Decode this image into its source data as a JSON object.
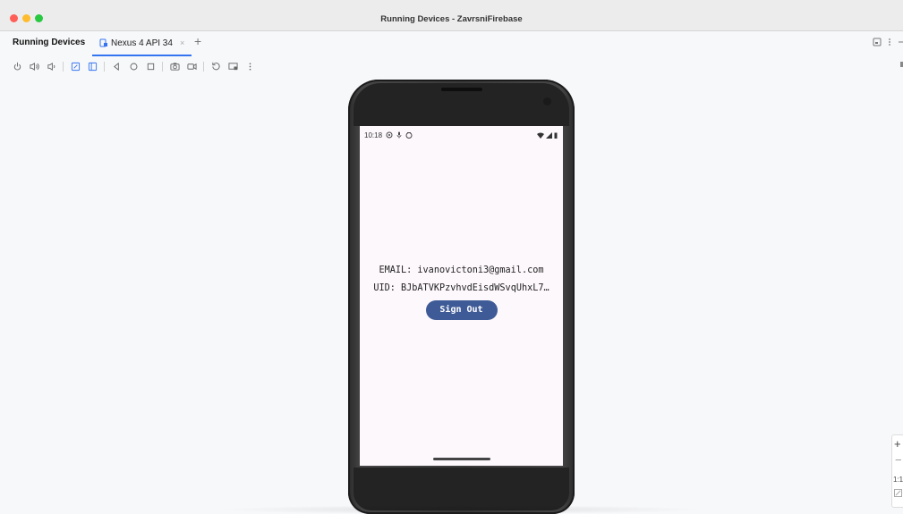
{
  "window": {
    "title": "Running Devices - ZavrsniFirebase"
  },
  "tabbar": {
    "panel_title": "Running Devices",
    "device_tab_label": "Nexus 4 API 34",
    "close_glyph": "×",
    "add_glyph": "+",
    "right_icons": [
      "window-icon",
      "more-icon",
      "minimize-icon"
    ]
  },
  "toolbar": {
    "buttons": [
      "power-icon",
      "volume-up-icon",
      "volume-down-icon",
      "rotate-left-icon",
      "rotate-right-icon",
      "back-icon",
      "home-icon",
      "overview-icon",
      "screenshot-icon",
      "screen-record-icon",
      "snapshot-icon",
      "extended-controls-icon",
      "more-icon"
    ]
  },
  "device": {
    "status_time": "10:18",
    "status_icons_left": [
      "settings-icon",
      "mic-icon",
      "notification-icon"
    ],
    "status_icons_right": [
      "wifi-icon",
      "signal-icon",
      "battery-icon"
    ],
    "email_line": "EMAIL: ivanovictoni3@gmail.com",
    "uid_line": "UID: BJbATVKPzvhvdEisdWSvqUhxL7…",
    "signout_label": "Sign Out",
    "button_color": "#3f5b97"
  },
  "zoom": {
    "plus": "+",
    "minus": "−",
    "actual_size": "1:1"
  },
  "colors": {
    "accent": "#3574f0",
    "traffic_close": "#ff5f57",
    "traffic_min": "#febc2e",
    "traffic_max": "#28c840"
  }
}
